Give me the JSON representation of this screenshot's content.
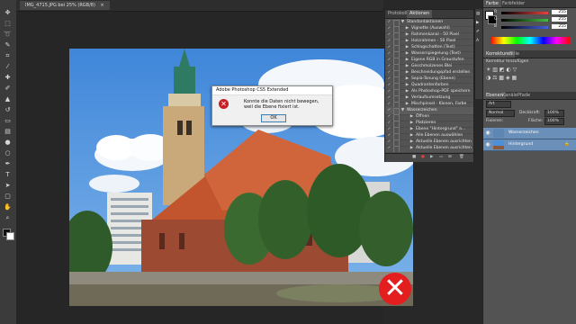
{
  "document_tab": {
    "label": "IMG_4715.JPG bei 25% (RGB/8)",
    "close": "×"
  },
  "dialog": {
    "title": "Adobe Photoshop CS5 Extended",
    "message": "Konnte die Daten nicht bewegen, weil die Ebene fixiert ist.",
    "icon": "error-icon",
    "ok_label": "OK"
  },
  "actions_panel": {
    "tabs": [
      "Protokoll",
      "Aktionen"
    ],
    "items": [
      {
        "label": "Standardaktionen",
        "type": "set"
      },
      {
        "label": "Vignette (Auswahl)",
        "type": "action"
      },
      {
        "label": "Rahmenkanal - 50 Pixel",
        "type": "action"
      },
      {
        "label": "Holzrahmen - 50 Pixel",
        "type": "action"
      },
      {
        "label": "Schlagschatten (Text)",
        "type": "action"
      },
      {
        "label": "Wasserspiegelung (Text)",
        "type": "action"
      },
      {
        "label": "Eigene RGB in Graustufen",
        "type": "action"
      },
      {
        "label": "Geschmolzenes Blei",
        "type": "action"
      },
      {
        "label": "Beschneidungspfad erstellen",
        "type": "action"
      },
      {
        "label": "Sepia-Tonung (Ebene)",
        "type": "action"
      },
      {
        "label": "Quadrantenfarben",
        "type": "action"
      },
      {
        "label": "Als Photoshop-PDF speichern",
        "type": "action"
      },
      {
        "label": "Verlaufsumsetzung",
        "type": "action"
      },
      {
        "label": "Mischpinsel - Klonen, Farbe",
        "type": "action"
      },
      {
        "label": "Wasserzeichen",
        "type": "set"
      },
      {
        "label": "Öffnen",
        "type": "step"
      },
      {
        "label": "Platzieren",
        "type": "step"
      },
      {
        "label": "Ebene \"Hintergrund\" a...",
        "type": "step"
      },
      {
        "label": "Alle Ebenen auswählen",
        "type": "step"
      },
      {
        "label": "Aktuelle Ebenen ausrichten",
        "type": "step"
      },
      {
        "label": "Aktuelle Ebenen ausrichten",
        "type": "step"
      }
    ]
  },
  "color_panel": {
    "tabs": [
      "Farbe",
      "Farbfelder"
    ],
    "channels": [
      {
        "name": "R",
        "value": "255",
        "color": "#e84040"
      },
      {
        "name": "G",
        "value": "255",
        "color": "#40c040"
      },
      {
        "name": "B",
        "value": "255",
        "color": "#4060e8"
      }
    ]
  },
  "adjustments_panel": {
    "tabs": [
      "Korrekturen",
      "Stile"
    ],
    "heading": "Korrektur hinzufügen"
  },
  "layers_panel": {
    "tabs": [
      "Ebenen",
      "Kanäle",
      "Pfade"
    ],
    "blend_mode": "Normal",
    "opacity_label": "Deckkraft:",
    "opacity_value": "100%",
    "lock_label": "Fixieren:",
    "fill_label": "Fläche:",
    "fill_value": "100%",
    "kind_filter": "Art",
    "layers": [
      {
        "name": "Wasserzeichen",
        "selected": true
      },
      {
        "name": "Hintergrund",
        "selected": true
      }
    ]
  },
  "badge": {
    "symbol": "✕",
    "color": "#e41e1e"
  },
  "tool_icons": [
    "move-icon",
    "marquee-icon",
    "lasso-icon",
    "quick-select-icon",
    "crop-icon",
    "eyedropper-icon",
    "healing-icon",
    "brush-icon",
    "clone-stamp-icon",
    "history-brush-icon",
    "eraser-icon",
    "gradient-icon",
    "blur-icon",
    "dodge-icon",
    "pen-icon",
    "type-icon",
    "path-select-icon",
    "shape-icon",
    "hand-icon",
    "zoom-icon"
  ]
}
